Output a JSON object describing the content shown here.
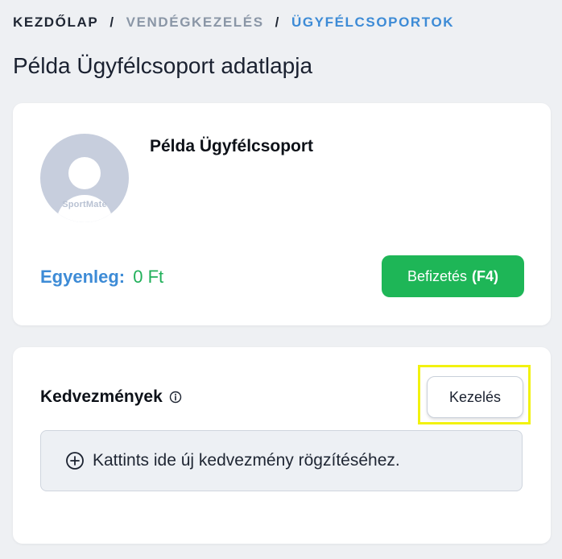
{
  "breadcrumb": {
    "items": [
      "KEZDŐLAP",
      "VENDÉGKEZELÉS",
      "ÜGYFÉLCSOPORTOK"
    ],
    "separator": "/"
  },
  "page": {
    "title": "Példa Ügyfélcsoport adatlapja"
  },
  "profile": {
    "name": "Példa Ügyfélcsoport",
    "avatar_logo": "SportMate",
    "balance_label": "Egyenleg:",
    "balance_value": "0 Ft",
    "pay_button_label": "Befizetés",
    "pay_button_shortcut": "(F4)"
  },
  "discounts": {
    "title": "Kedvezmények",
    "info_icon": "info-circle-icon",
    "manage_button_label": "Kezelés",
    "add_text": "Kattints ide új kedvezmény rögzítéséhez.",
    "add_icon": "plus-circle-icon"
  },
  "colors": {
    "accent_blue": "#3d8bd6",
    "success_green": "#1eb657",
    "highlight_yellow": "#f2f20f",
    "page_background": "#eef0f3"
  }
}
